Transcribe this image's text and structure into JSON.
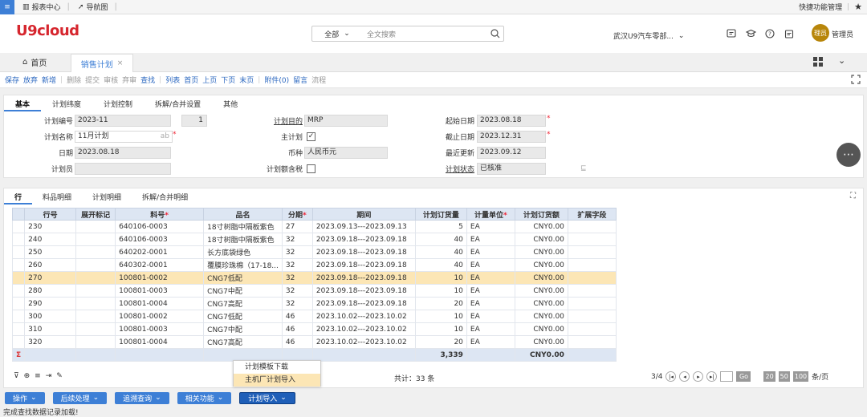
{
  "topbar": {
    "menu_icon": "menu-icon",
    "report_center": "报表中心",
    "nav_map": "导航图",
    "quick_manage": "快捷功能管理"
  },
  "header": {
    "logo": "U9cloud",
    "search_scope": "全部",
    "search_placeholder": "全文搜索",
    "org": "武汉U9汽车零部...",
    "avatar_text": "理员",
    "username": "管理员"
  },
  "tabs": {
    "home": "首页",
    "sales_plan": "销售计划",
    "close": "×"
  },
  "toolbar": [
    {
      "label": "保存",
      "enabled": true
    },
    {
      "label": "放弃",
      "enabled": true
    },
    {
      "label": "新增",
      "enabled": true
    },
    {
      "label": "删除",
      "enabled": false
    },
    {
      "label": "提交",
      "enabled": false
    },
    {
      "label": "审核",
      "enabled": false
    },
    {
      "label": "弃审",
      "enabled": false
    },
    {
      "label": "查找",
      "enabled": true
    },
    {
      "label": "列表",
      "enabled": true
    },
    {
      "label": "首页",
      "enabled": true
    },
    {
      "label": "上页",
      "enabled": true
    },
    {
      "label": "下页",
      "enabled": true
    },
    {
      "label": "末页",
      "enabled": true
    },
    {
      "label": "附件(0)",
      "enabled": true
    },
    {
      "label": "留言",
      "enabled": true
    },
    {
      "label": "流程",
      "enabled": false
    }
  ],
  "form": {
    "tabs": [
      "基本",
      "计划纬度",
      "计划控制",
      "拆解/合并设置",
      "其他"
    ],
    "plan_no_label": "计划编号",
    "plan_no": "2023-11",
    "plan_no_seq": "1",
    "plan_name_label": "计划名称",
    "plan_name": "11月计划",
    "plan_name_hint": "ab",
    "date_label": "日期",
    "date": "2023.08.18",
    "planner_label": "计划员",
    "planner": "",
    "purpose_label": "计划目的",
    "purpose": "MRP",
    "main_plan_label": "主计划",
    "main_plan_checked": "✓",
    "currency_label": "币种",
    "currency": "人民币元",
    "tax_label": "计划额含税",
    "tax_checked": "",
    "start_label": "起始日期",
    "start": "2023.08.18",
    "end_label": "截止日期",
    "end": "2023.12.31",
    "updated_label": "最近更新",
    "updated": "2023.09.12",
    "status_label": "计划状态",
    "status": "已核准",
    "req": "*"
  },
  "grid": {
    "tabs": [
      "行",
      "料品明细",
      "计划明细",
      "拆解/合并明细"
    ],
    "columns": [
      "",
      "行号",
      "展开标记",
      "料号",
      "品名",
      "分期",
      "期间",
      "计划订货量",
      "计量单位",
      "计划订货额",
      "扩展字段"
    ],
    "rows": [
      {
        "line": "230",
        "expand": "",
        "item": "640106-0003",
        "name": "18寸树脂中隔板紫色",
        "period": "27",
        "range": "2023.09.13---2023.09.13",
        "qty": "5",
        "uom": "EA",
        "amt": "CNY0.00"
      },
      {
        "line": "240",
        "expand": "",
        "item": "640106-0003",
        "name": "18寸树脂中隔板紫色",
        "period": "32",
        "range": "2023.09.18---2023.09.18",
        "qty": "40",
        "uom": "EA",
        "amt": "CNY0.00"
      },
      {
        "line": "250",
        "expand": "",
        "item": "640202-0001",
        "name": "长方底袋绿色",
        "period": "32",
        "range": "2023.09.18---2023.09.18",
        "qty": "40",
        "uom": "EA",
        "amt": "CNY0.00"
      },
      {
        "line": "260",
        "expand": "",
        "item": "640302-0001",
        "name": "覆膜珍珠棉（17-18...",
        "period": "32",
        "range": "2023.09.18---2023.09.18",
        "qty": "40",
        "uom": "EA",
        "amt": "CNY0.00"
      },
      {
        "line": "270",
        "expand": "",
        "item": "100801-0002",
        "name": "CNG7低配",
        "period": "32",
        "range": "2023.09.18---2023.09.18",
        "qty": "10",
        "uom": "EA",
        "amt": "CNY0.00"
      },
      {
        "line": "280",
        "expand": "",
        "item": "100801-0003",
        "name": "CNG7中配",
        "period": "32",
        "range": "2023.09.18---2023.09.18",
        "qty": "10",
        "uom": "EA",
        "amt": "CNY0.00"
      },
      {
        "line": "290",
        "expand": "",
        "item": "100801-0004",
        "name": "CNG7高配",
        "period": "32",
        "range": "2023.09.18---2023.09.18",
        "qty": "20",
        "uom": "EA",
        "amt": "CNY0.00"
      },
      {
        "line": "300",
        "expand": "",
        "item": "100801-0002",
        "name": "CNG7低配",
        "period": "46",
        "range": "2023.10.02---2023.10.02",
        "qty": "10",
        "uom": "EA",
        "amt": "CNY0.00"
      },
      {
        "line": "310",
        "expand": "",
        "item": "100801-0003",
        "name": "CNG7中配",
        "period": "46",
        "range": "2023.10.02---2023.10.02",
        "qty": "10",
        "uom": "EA",
        "amt": "CNY0.00"
      },
      {
        "line": "320",
        "expand": "",
        "item": "100801-0004",
        "name": "CNG7高配",
        "period": "46",
        "range": "2023.10.02---2023.10.02",
        "qty": "20",
        "uom": "EA",
        "amt": "CNY0.00"
      }
    ],
    "highlight_row": 4,
    "sum_symbol": "Σ",
    "sum_qty": "3,339",
    "sum_amt": "CNY0.00",
    "total": "共计：33 条",
    "page": "3/4",
    "go": "Go",
    "sizes": [
      "20",
      "50",
      "100"
    ],
    "size_unit": "条/页"
  },
  "popup": {
    "items": [
      "计划模板下载",
      "主机厂计划导入"
    ],
    "selected": 1
  },
  "bottom_buttons": [
    "操作",
    "后续处理",
    "追溯查询",
    "相关功能",
    "计划导入"
  ],
  "status": "完成查找数据记录加载!"
}
